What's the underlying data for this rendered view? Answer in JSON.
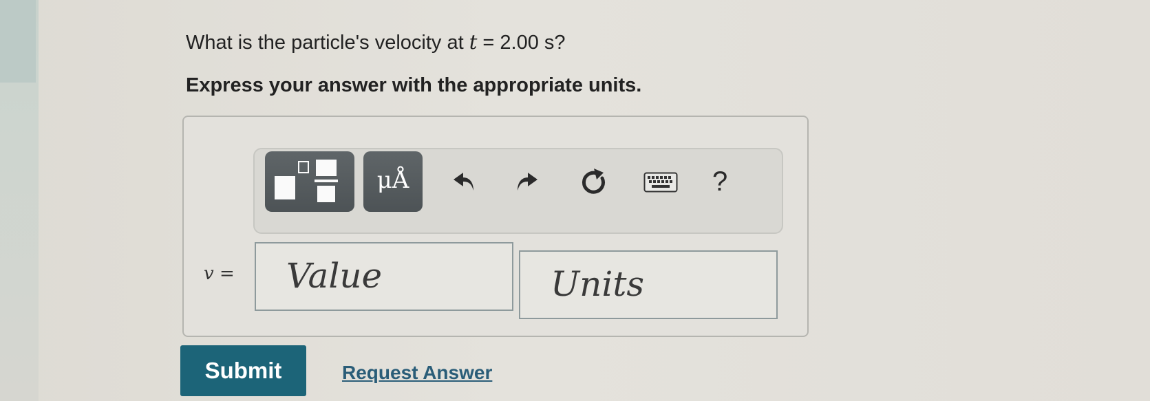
{
  "question": {
    "prefix": "What is the particle's velocity at ",
    "variable": "t",
    "suffix": " = 2.00 s?"
  },
  "instruction": "Express your answer with the appropriate units.",
  "toolbar": {
    "units_glyph": "μÅ",
    "help_label": "?"
  },
  "answer": {
    "variable": "v",
    "equals": "=",
    "value_placeholder": "Value",
    "units_placeholder": "Units"
  },
  "actions": {
    "submit_label": "Submit",
    "request_answer_label": "Request Answer"
  },
  "colors": {
    "submit_bg": "#1c6478",
    "link": "#2a5d78",
    "tool_button": "#52585b"
  }
}
